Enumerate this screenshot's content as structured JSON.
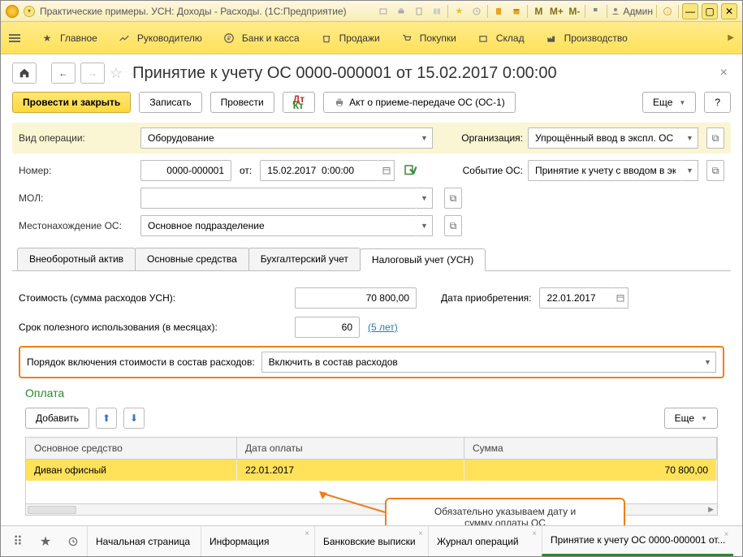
{
  "titlebar": {
    "title": "Практические примеры. УСН: Доходы - Расходы.  (1С:Предприятие)",
    "memory": {
      "m": "M",
      "mplus": "M+",
      "mminus": "M-"
    },
    "user_label": "Админ"
  },
  "mainnav": {
    "items": [
      "Главное",
      "Руководителю",
      "Банк и касса",
      "Продажи",
      "Покупки",
      "Склад",
      "Производство"
    ]
  },
  "heading": "Принятие к учету ОС 0000-000001 от 15.02.2017 0:00:00",
  "toolbar": {
    "post_close": "Провести и закрыть",
    "save": "Записать",
    "post": "Провести",
    "print_act": "Акт о приеме-передаче ОС (ОС-1)",
    "more": "Еще",
    "help": "?"
  },
  "form": {
    "op_label": "Вид операции:",
    "op_value": "Оборудование",
    "org_label": "Организация:",
    "org_value": "Упрощённый ввод в экспл. ОС (",
    "num_label": "Номер:",
    "num_value": "0000-000001",
    "ot_label": "от:",
    "date_value": "15.02.2017  0:00:00",
    "event_label": "Событие ОС:",
    "event_value": "Принятие к учету с вводом в эк",
    "mol_label": "МОЛ:",
    "mol_value": "",
    "loc_label": "Местонахождение ОС:",
    "loc_value": "Основное подразделение"
  },
  "tabs": [
    "Внеоборотный актив",
    "Основные средства",
    "Бухгалтерский учет",
    "Налоговый учет (УСН)"
  ],
  "active_tab": 3,
  "usn": {
    "cost_label": "Стоимость (сумма расходов УСН):",
    "cost_value": "70 800,00",
    "acq_label": "Дата приобретения:",
    "acq_value": "22.01.2017",
    "life_label": "Срок полезного использования (в месяцах):",
    "life_value": "60",
    "life_hint": "(5 лет)",
    "order_label": "Порядок включения стоимости в состав расходов:",
    "order_value": "Включить в состав расходов"
  },
  "payment": {
    "section": "Оплата",
    "add": "Добавить",
    "more": "Еще",
    "headers": [
      "Основное средство",
      "Дата оплаты",
      "Сумма"
    ],
    "rows": [
      {
        "asset": "Диван офисный",
        "date": "22.01.2017",
        "sum": "70 800,00"
      }
    ]
  },
  "callout": {
    "l1": "Обязательно указываем дату и",
    "l2": "сумму оплаты ОС"
  },
  "statusbar": {
    "tabs": [
      "Начальная страница",
      "Информация",
      "Банковские выписки",
      "Журнал операций",
      "Принятие к учету ОС 0000-000001 от..."
    ],
    "closable": [
      false,
      true,
      true,
      true,
      true
    ],
    "active": 4
  }
}
